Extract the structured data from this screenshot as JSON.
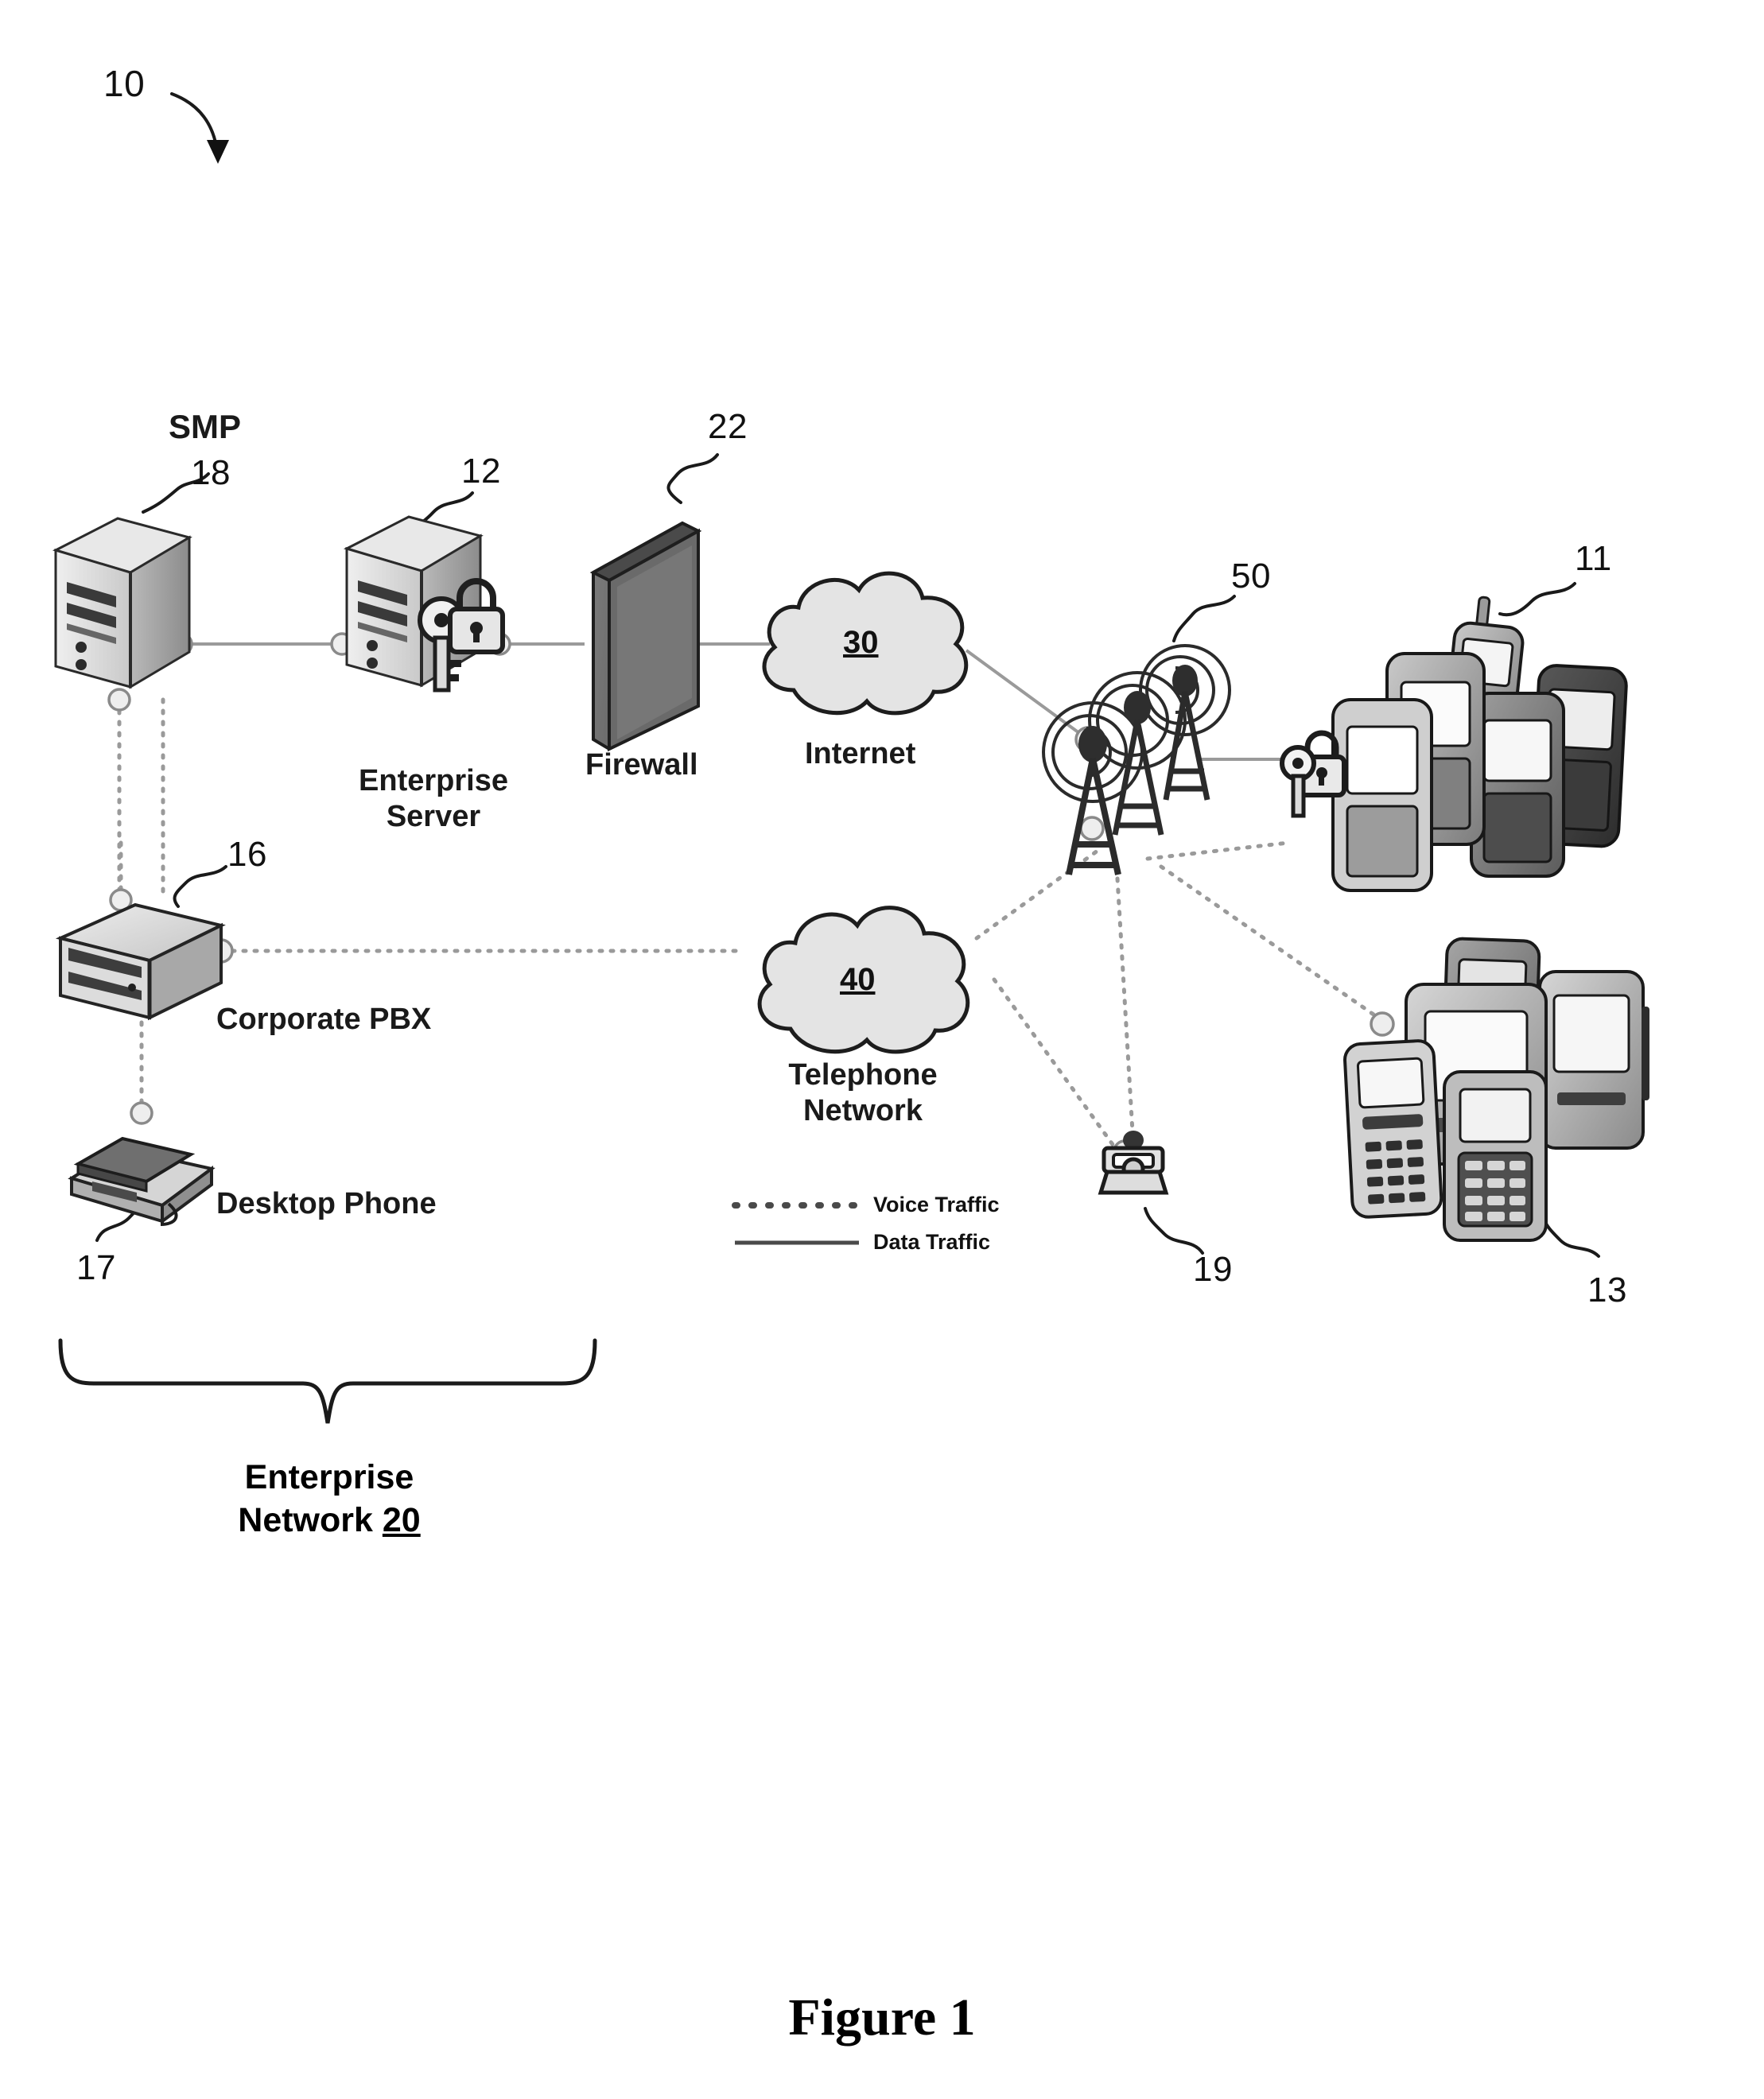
{
  "figure": {
    "caption": "Figure 1",
    "system_ref": "10"
  },
  "legend": {
    "voice_label": "Voice Traffic",
    "data_label": "Data Traffic",
    "voice_style": "dotted",
    "data_style": "solid"
  },
  "enterprise_brace": {
    "line1": "Enterprise",
    "line2_prefix": "Network ",
    "line2_ref": "20"
  },
  "nodes": [
    {
      "id": "smp",
      "name": "SMP",
      "label": "SMP",
      "ref": "18",
      "icon": "server-tower-icon"
    },
    {
      "id": "enterprise_server",
      "label_line1": "Enterprise",
      "label_line2": "Server",
      "ref": "12",
      "icon": "server-tower-with-key-lock-icon"
    },
    {
      "id": "firewall",
      "label": "Firewall",
      "ref": "22",
      "icon": "firewall-brick-icon"
    },
    {
      "id": "internet",
      "label": "Internet",
      "ref": "30",
      "icon": "cloud-icon"
    },
    {
      "id": "corporate_pbx",
      "label": "Corporate PBX",
      "ref": "16",
      "icon": "pbx-box-icon"
    },
    {
      "id": "desktop_phone",
      "label": "Desktop Phone",
      "ref": "17",
      "icon": "desk-phone-icon"
    },
    {
      "id": "telephone_network",
      "label_line1": "Telephone",
      "label_line2": "Network",
      "ref": "40",
      "icon": "cloud-icon"
    },
    {
      "id": "cell_towers",
      "label": "",
      "ref": "50",
      "icon": "cell-tower-icon"
    },
    {
      "id": "mobile_devices_secure",
      "label": "",
      "ref": "11",
      "icon": "smartphone-cluster-icon"
    },
    {
      "id": "mobile_devices_legacy",
      "label": "",
      "ref": "13",
      "icon": "mobile-phone-cluster-icon"
    },
    {
      "id": "remote_phone",
      "label": "",
      "ref": "19",
      "icon": "telephone-icon"
    }
  ],
  "colors": {
    "ink": "#1a1a1a",
    "line": "#8a8a8a",
    "body_light": "#d8d8d8",
    "body_mid": "#b4b4b4",
    "body_dark": "#8e8e8e",
    "firewall_face": "#6e6e6e",
    "firewall_side": "#4f4f4f",
    "cloud_fill": "#e3e3e3"
  }
}
